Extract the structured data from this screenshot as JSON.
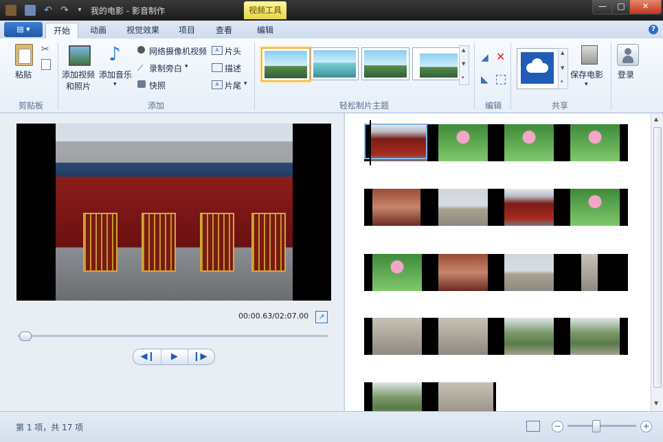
{
  "window": {
    "title": "我的电影 - 影音制作",
    "context_tab": "视频工具",
    "minimize": "—",
    "maximize": "□",
    "close": "✕"
  },
  "tabs": [
    {
      "label": "开始",
      "active": true
    },
    {
      "label": "动画",
      "active": false
    },
    {
      "label": "视觉效果",
      "active": false
    },
    {
      "label": "项目",
      "active": false
    },
    {
      "label": "查看",
      "active": false
    },
    {
      "label": "编辑",
      "active": false
    }
  ],
  "file_button": "▤ ▾",
  "help": "?",
  "ribbon": {
    "clipboard": {
      "paste": "粘贴",
      "group": "剪贴板"
    },
    "add": {
      "add_video_line1": "添加视频",
      "add_video_line2": "和照片",
      "add_music": "添加音乐",
      "webcam": "网络摄像机视频",
      "narration": "录制旁白",
      "snapshot": "快照",
      "title": "片头",
      "caption": "描述",
      "credits": "片尾",
      "group": "添加"
    },
    "themes": {
      "group": "轻松制片主题"
    },
    "edit": {
      "group": "编辑"
    },
    "share": {
      "save_movie": "保存电影",
      "group": "共享"
    },
    "signin": {
      "label": "登录"
    }
  },
  "preview": {
    "timecode": "00:00.63/02:07.00",
    "progress_fraction": 0.005
  },
  "playback": {
    "prev": "◀❙",
    "play": "▶",
    "next": "❙▶"
  },
  "status": {
    "text": "第 1 项，共 17 项",
    "zoom_out": "−",
    "zoom_in": "+"
  },
  "colors": {
    "accent": "#1e57a8",
    "skydrive_tile": "#1e5cb8",
    "selection": "#f0b43a"
  }
}
